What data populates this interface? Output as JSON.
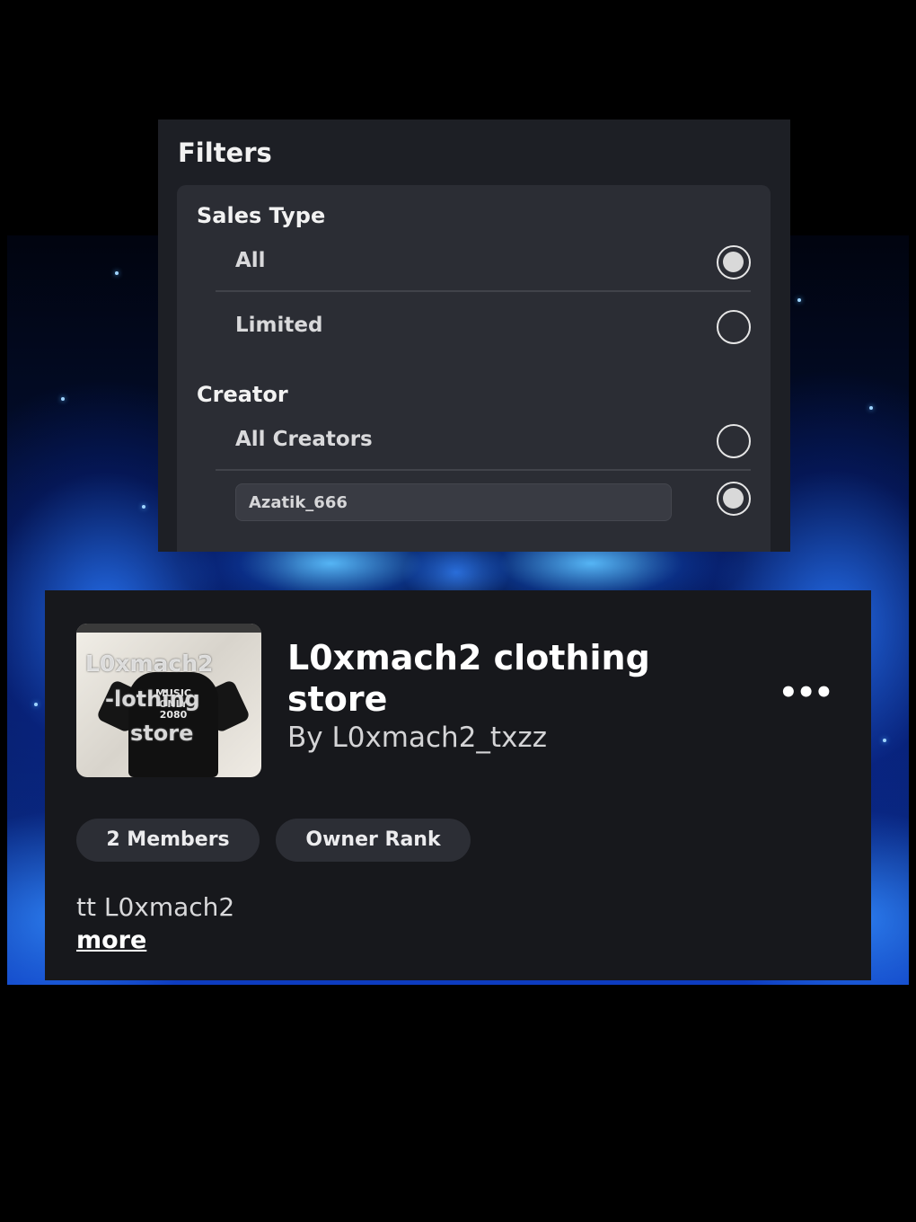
{
  "filters": {
    "title": "Filters",
    "sales_type": {
      "label": "Sales Type",
      "options": [
        {
          "label": "All",
          "selected": true
        },
        {
          "label": "Limited",
          "selected": false
        }
      ]
    },
    "creator": {
      "label": "Creator",
      "options": [
        {
          "label": "All Creators",
          "selected": false
        }
      ],
      "input_value": "Azatik_666",
      "input_selected": true
    }
  },
  "group": {
    "thumbnail_watermark": [
      "L0xmach2",
      "-lothing",
      "store"
    ],
    "thumbnail_shirt_text": "MUSIC ONLY 2080",
    "title": "L0xmach2 clothing store",
    "owner": "By L0xmach2_txzz",
    "more_menu": "•••",
    "tags": [
      "2 Members",
      "Owner Rank"
    ],
    "description": "tt L0xmach2",
    "more_link": "more"
  },
  "colors": {
    "background": "#000000",
    "panel": "#1d1f25",
    "card": "#2b2d34",
    "group_card": "#17181c",
    "pill": "#2c2e35",
    "wallpaper_accent": "#2f7fff"
  }
}
